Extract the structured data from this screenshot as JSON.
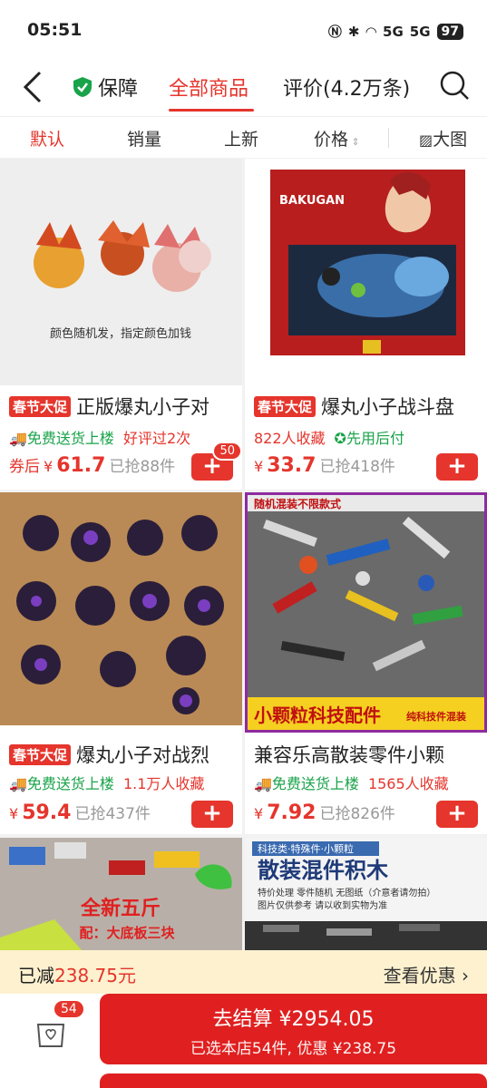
{
  "status": {
    "time": "05:51",
    "net1": "5G",
    "net2": "5G",
    "battery": "97"
  },
  "nav": {
    "guarantee": "保障",
    "tab_all": "全部商品",
    "tab_reviews": "评价(4.2万条)"
  },
  "sort": {
    "default": "默认",
    "sales": "销量",
    "new": "上新",
    "price": "价格",
    "big": "大图"
  },
  "products": [
    {
      "img_caption": "颜色随机发，指定颜色加钱",
      "promo": "春节大促",
      "title": "正版爆丸小子对",
      "tag1": "免费送货上楼",
      "tag2": "好评过2次",
      "coupon": "券后",
      "currency": "¥",
      "price": "61.7",
      "sold": "已抢88件",
      "add": "+",
      "badge": "50"
    },
    {
      "img_caption": "BAKUGAN BATTLE ARENA",
      "promo": "春节大促",
      "title": "爆丸小子战斗盘",
      "tag1": "822人收藏",
      "tag2": "先用后付",
      "currency": "¥",
      "price": "33.7",
      "sold": "已抢418件",
      "add": "+"
    },
    {
      "promo": "春节大促",
      "title": "爆丸小子对战烈",
      "tag1": "免费送货上楼",
      "tag2": "1.1万人收藏",
      "currency": "¥",
      "price": "59.4",
      "sold": "已抢437件",
      "add": "+"
    },
    {
      "img_top": "随机混装不限款式",
      "img_bottom": "小颗粒科技配件",
      "img_bottom2": "纯科技件混装",
      "title": "兼容乐高散装零件小颗",
      "tag1": "免费送货上楼",
      "tag2": "1565人收藏",
      "currency": "¥",
      "price": "7.92",
      "sold": "已抢826件",
      "add": "+"
    },
    {
      "img_text1": "全新五斤",
      "img_text2": "配：大底板三块"
    },
    {
      "img_text1": "科技类·特殊件·小颗粒",
      "img_text2": "散装混件积木",
      "img_text3": "特价处理 零件随机 无图纸（介意者请勿拍）",
      "img_text4": "图片仅供参考 请以收到实物为准"
    }
  ],
  "savebar": {
    "label": "已减",
    "amount": "238.75元",
    "view": "查看优惠"
  },
  "bottom": {
    "cart_count": "54",
    "checkout": "去结算 ¥2954.05",
    "sub": "已选本店54件, 优惠 ¥238.75"
  }
}
